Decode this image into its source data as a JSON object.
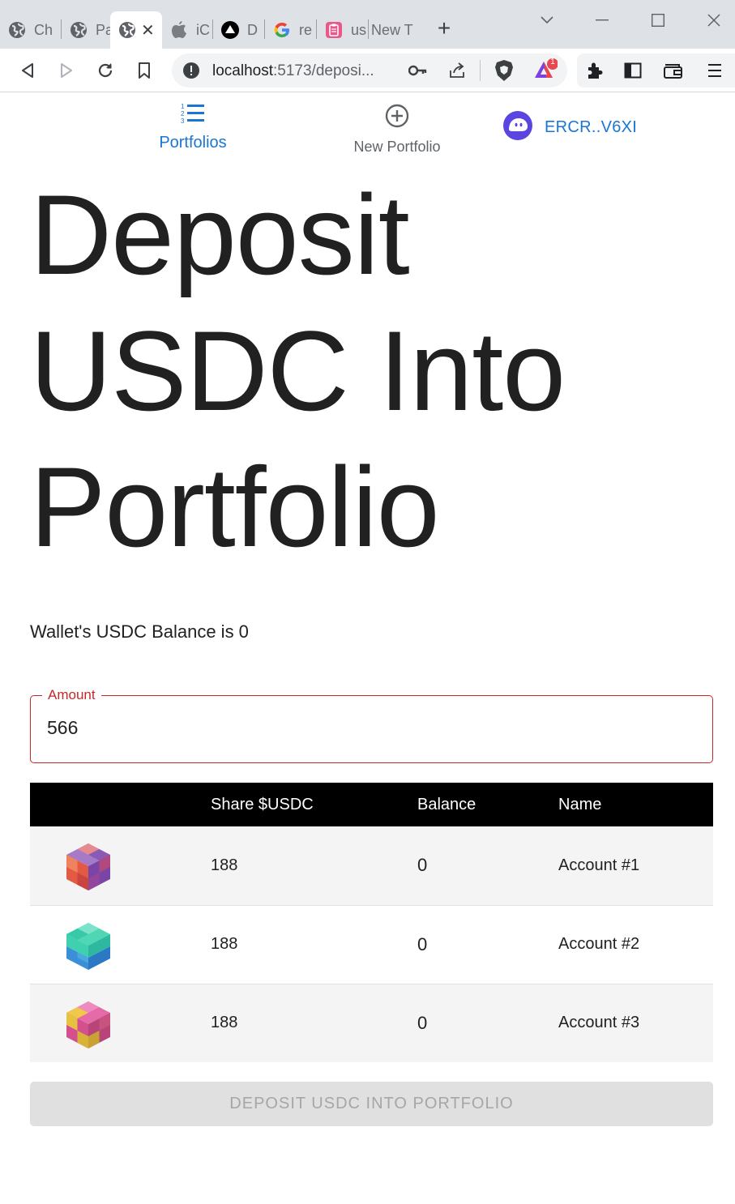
{
  "browser": {
    "tabs": [
      {
        "label": "Ch",
        "icon": "globe-icon"
      },
      {
        "label": "Pa",
        "icon": "globe-icon"
      },
      {
        "label": "",
        "icon": "globe-icon",
        "active": true
      },
      {
        "label": "iC",
        "icon": "apple-icon"
      },
      {
        "label": "D",
        "icon": "vercel-icon"
      },
      {
        "label": "re",
        "icon": "google-icon"
      },
      {
        "label": "us",
        "icon": "clipboard-icon"
      },
      {
        "label": "New T",
        "icon": ""
      }
    ],
    "close_symbol": "✕",
    "newtab_symbol": "+",
    "url_host": "localhost",
    "url_path": ":5173/deposi...",
    "brave_badge": "1"
  },
  "nav": {
    "portfolios_label": "Portfolios",
    "new_portfolio_label": "New Portfolio",
    "account_label": "ERCR..V6XI"
  },
  "page": {
    "title": "Deposit USDC Into Portfolio",
    "balance_text": "Wallet's USDC Balance is 0",
    "amount_label": "Amount",
    "amount_value": "566",
    "deposit_button": "DEPOSIT USDC INTO PORTFOLIO"
  },
  "table": {
    "headers": [
      "",
      "Share $USDC",
      "Balance",
      "Name"
    ],
    "rows": [
      {
        "share": "188",
        "balance": "0",
        "name": "Account #1",
        "avatar": "cube-avatar-red-purple"
      },
      {
        "share": "188",
        "balance": "0",
        "name": "Account #2",
        "avatar": "cube-avatar-teal-blue"
      },
      {
        "share": "188",
        "balance": "0",
        "name": "Account #3",
        "avatar": "cube-avatar-pink-yellow"
      }
    ]
  },
  "colors": {
    "accent": "#1976d2",
    "error": "#c62828",
    "header_bg": "#000000",
    "row_alt": "#f4f4f4",
    "button_disabled": "#e0e0e0"
  }
}
